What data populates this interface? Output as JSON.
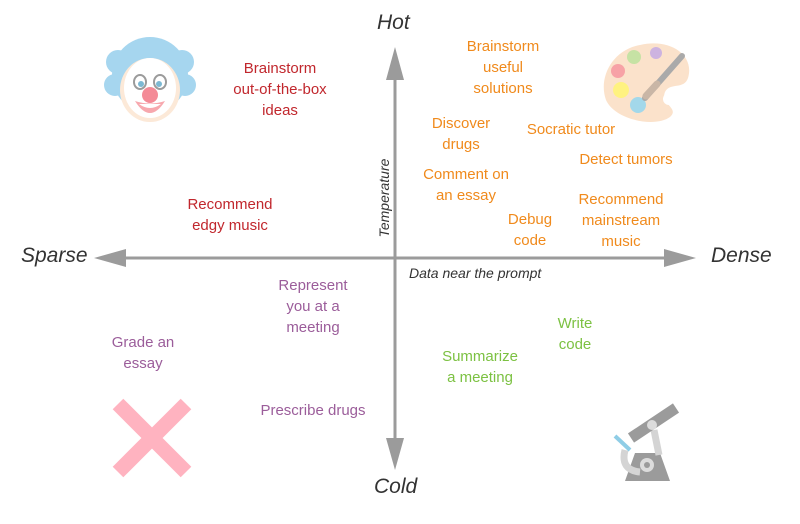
{
  "axes": {
    "top": "Hot",
    "bottom": "Cold",
    "left": "Sparse",
    "right": "Dense",
    "vertical_name": "Temperature",
    "horizontal_name": "Data near the prompt",
    "color": "#9b9b9b"
  },
  "colors": {
    "red": "#c1272d",
    "orange": "#f08a1c",
    "purple": "#9b5d9a",
    "green": "#7cc142"
  },
  "items": {
    "brainstorm_box": "Brainstorm\nout-of-the-box\nideas",
    "edgy_music": "Recommend\nedgy music",
    "brainstorm_useful": "Brainstorm\nuseful\nsolutions",
    "discover_drugs": "Discover\ndrugs",
    "socratic": "Socratic tutor",
    "detect_tumors": "Detect tumors",
    "comment_essay": "Comment on\nan essay",
    "debug_code": "Debug\ncode",
    "mainstream_music": "Recommend\nmainstream\nmusic",
    "represent": "Represent\nyou at a\nmeeting",
    "grade_essay": "Grade an\nessay",
    "prescribe": "Prescribe drugs",
    "write_code": "Write\ncode",
    "summarize": "Summarize\na meeting"
  },
  "icons": {
    "top_left": "clown-icon",
    "top_right": "palette-icon",
    "bottom_left": "x-mark-icon",
    "bottom_right": "microscope-icon"
  }
}
